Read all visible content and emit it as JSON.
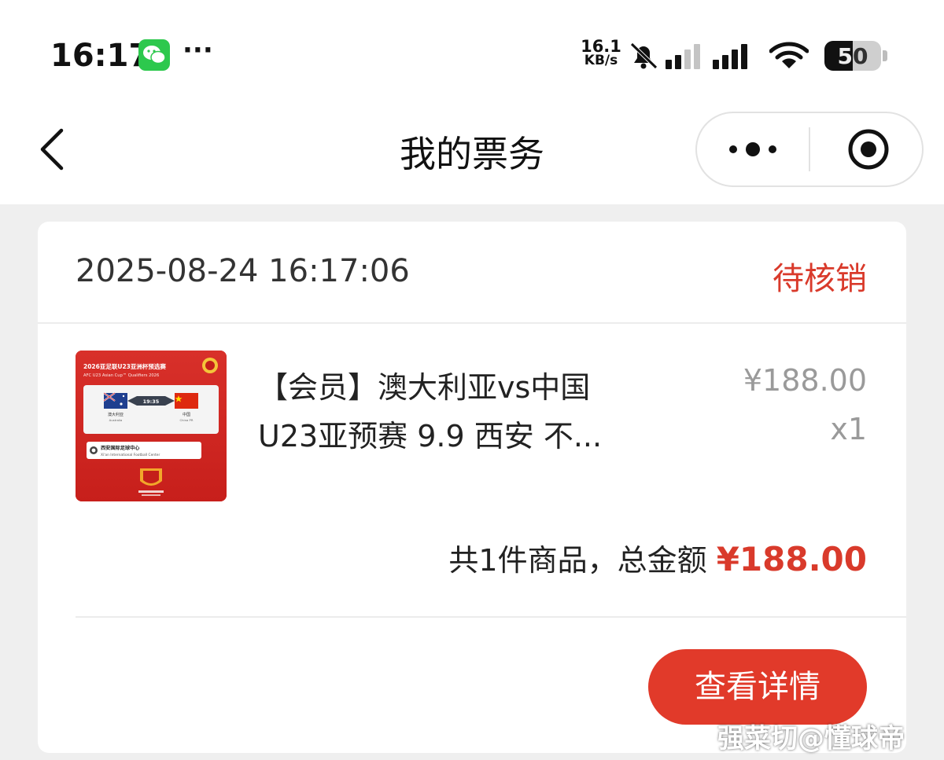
{
  "status_bar": {
    "time": "16:17",
    "dots": "···",
    "net_speed_value": "16.1",
    "net_speed_unit": "KB/s",
    "battery_level": "50"
  },
  "nav": {
    "title": "我的票务"
  },
  "order": {
    "datetime": "2025-08-24 16:17:06",
    "status": "待核销",
    "product_title_line1": "【会员】澳大利亚vs中国",
    "product_title_line2": "U23亚预赛 9.9 西安 不...",
    "price": "¥188.00",
    "quantity": "x1",
    "summary_prefix": "共1件商品，总金额",
    "total": "¥188.00",
    "detail_button": "查看详情"
  },
  "thumbnail": {
    "header_cn": "2026亚足联U23亚洲杯预选赛",
    "header_en": "AFC U23 Asian Cup™ Qualifiers 2026",
    "team_left_cn": "澳大利亚",
    "team_left_en": "Australia",
    "team_right_cn": "中国",
    "team_right_en": "China PR",
    "kickoff": "19:35",
    "venue_cn": "西安国际足球中心",
    "venue_en": "Xi'an International Football Center"
  },
  "watermark": "强菜切@懂球帝",
  "colors": {
    "accent_red": "#e13a2a",
    "status_red": "#d93a2b",
    "wechat_green": "#2dc84d"
  }
}
